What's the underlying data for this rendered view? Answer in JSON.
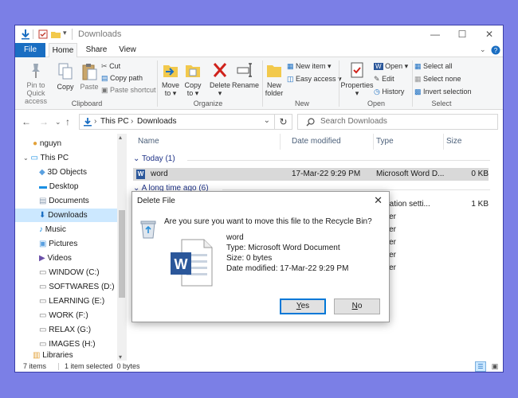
{
  "window": {
    "title": "Downloads"
  },
  "ribbon": {
    "tabs": [
      "File",
      "Home",
      "Share",
      "View"
    ],
    "clipboard": {
      "pin": [
        "Pin to Quick",
        "access"
      ],
      "copy": "Copy",
      "paste": "Paste",
      "cut": "Cut",
      "copy_path": "Copy path",
      "paste_shortcut": "Paste shortcut",
      "label": "Clipboard"
    },
    "organize": {
      "move_to": "Move",
      "copy_to": "Copy",
      "to": "to",
      "delete": "Delete",
      "rename": "Rename",
      "label": "Organize"
    },
    "new": {
      "new_folder": [
        "New",
        "folder"
      ],
      "new_item": "New item",
      "easy_access": "Easy access",
      "label": "New"
    },
    "open": {
      "properties": "Properties",
      "open": "Open",
      "edit": "Edit",
      "history": "History",
      "label": "Open"
    },
    "select": {
      "select_all": "Select all",
      "select_none": "Select none",
      "invert": "Invert selection",
      "label": "Select"
    }
  },
  "address": {
    "this_pc": "This PC",
    "downloads": "Downloads",
    "sep": "›",
    "search_placeholder": "Search Downloads"
  },
  "sidebar": {
    "items": [
      "nguyn",
      "This PC",
      "3D Objects",
      "Desktop",
      "Documents",
      "Downloads",
      "Music",
      "Pictures",
      "Videos",
      "WINDOW (C:)",
      "SOFTWARES (D:)",
      "LEARNING (E:)",
      "WORK (F:)",
      "RELAX (G:)",
      "IMAGES (H:)",
      "Libraries"
    ]
  },
  "columns": {
    "name": "Name",
    "date": "Date modified",
    "type": "Type",
    "size": "Size"
  },
  "groups": {
    "today": "Today (1)",
    "long_ago": "A long time ago (6)"
  },
  "rows": {
    "word": {
      "name": "word",
      "date": "17-Mar-22 9:29 PM",
      "type": "Microsoft Word D...",
      "size": "0 KB"
    },
    "partial": [
      {
        "type": "iguration setti...",
        "size": "1 KB"
      },
      {
        "type": "folder"
      },
      {
        "type": "folder"
      },
      {
        "type": "folder"
      },
      {
        "type": "folder"
      },
      {
        "type": "folder"
      }
    ]
  },
  "status": {
    "items": "7 items",
    "selected": "1 item selected  0 bytes"
  },
  "dialog": {
    "title": "Delete File",
    "question": "Are you sure you want to move this file to the Recycle Bin?",
    "file_name": "word",
    "file_type": "Type: Microsoft Word Document",
    "file_size": "Size: 0 bytes",
    "file_date": "Date modified: 17-Mar-22 9:29 PM",
    "yes_rest": "es",
    "no_rest": "o"
  },
  "colors": {
    "accent": "#1a6ec2",
    "selection": "#cce8ff",
    "background": "#7b7fe6"
  }
}
